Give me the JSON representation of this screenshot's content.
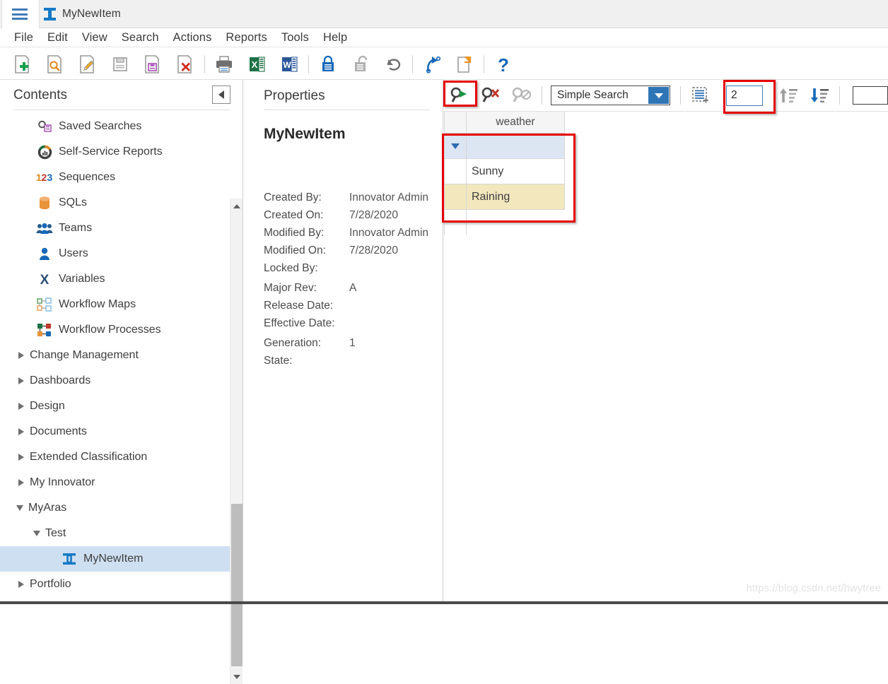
{
  "window": {
    "tab_title": "MyNewItem",
    "tab_icon": "ibeam-icon",
    "menu_icon": "hamburger-icon"
  },
  "menubar": {
    "items": [
      {
        "label": "File"
      },
      {
        "label": "Edit"
      },
      {
        "label": "View"
      },
      {
        "label": "Search"
      },
      {
        "label": "Actions"
      },
      {
        "label": "Reports"
      },
      {
        "label": "Tools"
      },
      {
        "label": "Help"
      }
    ]
  },
  "toolbar": {
    "buttons": [
      {
        "name": "new-item-button",
        "icon": "new-document-plus-icon"
      },
      {
        "name": "search-item-button",
        "icon": "document-search-icon"
      },
      {
        "name": "edit-item-button",
        "icon": "document-edit-pencil-icon"
      },
      {
        "name": "save-button",
        "icon": "save-floppy-icon"
      },
      {
        "name": "save-as-button",
        "icon": "save-as-floppy-icon"
      },
      {
        "name": "delete-button",
        "icon": "document-delete-x-icon"
      },
      {
        "name": "print-button",
        "icon": "printer-icon"
      },
      {
        "name": "export-excel-button",
        "icon": "excel-icon"
      },
      {
        "name": "export-word-button",
        "icon": "word-icon"
      },
      {
        "name": "lock-button",
        "icon": "lock-closed-icon"
      },
      {
        "name": "unlock-button",
        "icon": "lock-open-icon"
      },
      {
        "name": "undo-button",
        "icon": "undo-arrow-icon"
      },
      {
        "name": "promote-button",
        "icon": "promote-arrow-icon"
      },
      {
        "name": "copy-button",
        "icon": "copy-document-icon"
      },
      {
        "name": "help-button",
        "icon": "question-mark-icon"
      }
    ]
  },
  "sidebar": {
    "title": "Contents",
    "collapse_icon": "collapse-left-icon",
    "items": [
      {
        "label": "Saved Searches",
        "icon": "saved-search-icon",
        "indent": 1,
        "twisty": "none",
        "selected": false
      },
      {
        "label": "Self-Service Reports",
        "icon": "self-service-report-icon",
        "indent": 1,
        "twisty": "none",
        "selected": false
      },
      {
        "label": "Sequences",
        "icon": "sequences-123-icon",
        "indent": 1,
        "twisty": "none",
        "selected": false
      },
      {
        "label": "SQLs",
        "icon": "sql-database-icon",
        "indent": 1,
        "twisty": "none",
        "selected": false
      },
      {
        "label": "Teams",
        "icon": "teams-people-icon",
        "indent": 1,
        "twisty": "none",
        "selected": false
      },
      {
        "label": "Users",
        "icon": "user-person-icon",
        "indent": 1,
        "twisty": "none",
        "selected": false
      },
      {
        "label": "Variables",
        "icon": "variables-x-icon",
        "indent": 1,
        "twisty": "none",
        "selected": false
      },
      {
        "label": "Workflow Maps",
        "icon": "workflow-map-icon",
        "indent": 1,
        "twisty": "none",
        "selected": false
      },
      {
        "label": "Workflow Processes",
        "icon": "workflow-process-icon",
        "indent": 1,
        "twisty": "none",
        "selected": false
      },
      {
        "label": "Change Management",
        "icon": "none",
        "indent": 0,
        "twisty": "collapsed",
        "selected": false
      },
      {
        "label": "Dashboards",
        "icon": "none",
        "indent": 0,
        "twisty": "collapsed",
        "selected": false
      },
      {
        "label": "Design",
        "icon": "none",
        "indent": 0,
        "twisty": "collapsed",
        "selected": false
      },
      {
        "label": "Documents",
        "icon": "none",
        "indent": 0,
        "twisty": "collapsed",
        "selected": false
      },
      {
        "label": "Extended Classification",
        "icon": "none",
        "indent": 0,
        "twisty": "collapsed",
        "selected": false
      },
      {
        "label": "My Innovator",
        "icon": "none",
        "indent": 0,
        "twisty": "collapsed",
        "selected": false
      },
      {
        "label": "MyAras",
        "icon": "none",
        "indent": 0,
        "twisty": "expanded",
        "selected": false
      },
      {
        "label": "Test",
        "icon": "none",
        "indent": 1,
        "twisty": "expanded",
        "selected": false
      },
      {
        "label": "MyNewItem",
        "icon": "ibeam-icon",
        "indent": 2,
        "twisty": "none",
        "selected": true
      },
      {
        "label": "Portfolio",
        "icon": "none",
        "indent": 0,
        "twisty": "collapsed",
        "selected": false
      }
    ]
  },
  "properties": {
    "title": "Properties",
    "item_name": "MyNewItem",
    "rows": [
      {
        "label": "Created By:",
        "value": "Innovator Admin"
      },
      {
        "label": "Created On:",
        "value": "7/28/2020"
      },
      {
        "label": "Modified By:",
        "value": "Innovator Admin"
      },
      {
        "label": "Modified On:",
        "value": "7/28/2020"
      },
      {
        "label": "Locked By:",
        "value": ""
      },
      {
        "label": "Major Rev:",
        "value": "A"
      },
      {
        "label": "Release Date:",
        "value": ""
      },
      {
        "label": "Effective Date:",
        "value": ""
      },
      {
        "label": "Generation:",
        "value": "1"
      },
      {
        "label": "State:",
        "value": ""
      }
    ]
  },
  "search_toolbar": {
    "run_search_icon": "run-search-green-arrow-icon",
    "clear_search_icon": "clear-search-red-x-icon",
    "disable_search_icon": "disable-search-icon",
    "search_mode": "Simple Search",
    "search_mode_options": [
      "Simple Search"
    ],
    "select_all_icon": "select-all-rows-icon",
    "page_size_value": "2",
    "sort_asc_icon": "sort-ascending-icon",
    "sort_desc_icon": "sort-descending-icon",
    "page_number_value": ""
  },
  "results_grid": {
    "columns": [
      "weather"
    ],
    "search_row": {
      "weather": ""
    },
    "rows": [
      {
        "weather": "Sunny",
        "style": "white"
      },
      {
        "weather": "Raining",
        "style": "cream"
      }
    ],
    "gutter_icon": "row-dropdown-triangle-icon"
  },
  "annotations": {
    "run_search_highlight": "red-box",
    "page_size_highlight": "red-box",
    "results_highlight": "red-box"
  },
  "watermark": "https://blog.csdn.net/hwytree",
  "colors": {
    "accent_blue": "#2e75b6",
    "selection_blue": "#cfdff2",
    "search_row_blue": "#dce6f3",
    "modified_row_cream": "#f2e7bd",
    "annotation_red": "#e60000"
  }
}
